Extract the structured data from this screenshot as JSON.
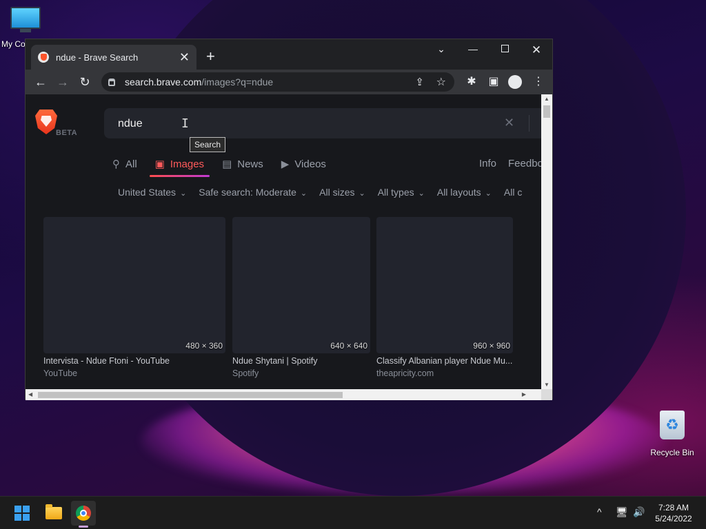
{
  "desktop": {
    "icons": {
      "my_computer": "My Co",
      "recycle_bin": "Recycle Bin"
    }
  },
  "browser": {
    "tab": {
      "title": "ndue - Brave Search",
      "close": "✕"
    },
    "new_tab": "+",
    "window_controls": {
      "tab_search": "⌄",
      "minimize": "—",
      "close": "✕"
    },
    "nav": {
      "back": "←",
      "forward": "→",
      "reload": "↻"
    },
    "url": {
      "host": "search.brave.com",
      "path": "/images?q=ndue"
    },
    "toolbar_icons": {
      "share": "⇪",
      "bookmark": "☆",
      "extensions": "✱",
      "side_panel": "▣",
      "menu": "⋮"
    }
  },
  "page": {
    "logo_badge": "BETA",
    "search": {
      "query": "ndue",
      "cursor": "I",
      "clear": "✕",
      "tooltip": "Search"
    },
    "tabs": [
      {
        "label": "All",
        "icon": "search-icon",
        "glyph": "⚲"
      },
      {
        "label": "Images",
        "icon": "image-icon",
        "glyph": "▣",
        "active": true
      },
      {
        "label": "News",
        "icon": "news-icon",
        "glyph": "▤"
      },
      {
        "label": "Videos",
        "icon": "video-icon",
        "glyph": "▶"
      }
    ],
    "info": "Info",
    "feedback": "Feedbc",
    "filters": [
      {
        "label": "United States"
      },
      {
        "label": "Safe search: Moderate"
      },
      {
        "label": "All sizes"
      },
      {
        "label": "All types"
      },
      {
        "label": "All layouts"
      },
      {
        "label": "All c"
      }
    ],
    "results": [
      {
        "dims": "480 × 360",
        "title": "Intervista - Ndue Ftoni - YouTube",
        "source": "YouTube"
      },
      {
        "dims": "640 × 640",
        "title": "Ndue Shytani | Spotify",
        "source": "Spotify"
      },
      {
        "dims": "960 × 960",
        "title": "Classify Albanian player Ndue Mu...",
        "source": "theapricity.com"
      }
    ]
  },
  "taskbar": {
    "tray": {
      "chevron": "^",
      "network": "🖥",
      "volume": "🔊"
    },
    "clock": {
      "time": "7:28 AM",
      "date": "5/24/2022"
    }
  },
  "colors": {
    "active_tab": "#ff5a5a",
    "page_bg": "#17181c",
    "accent_gradient_end": "#c03ad4"
  }
}
